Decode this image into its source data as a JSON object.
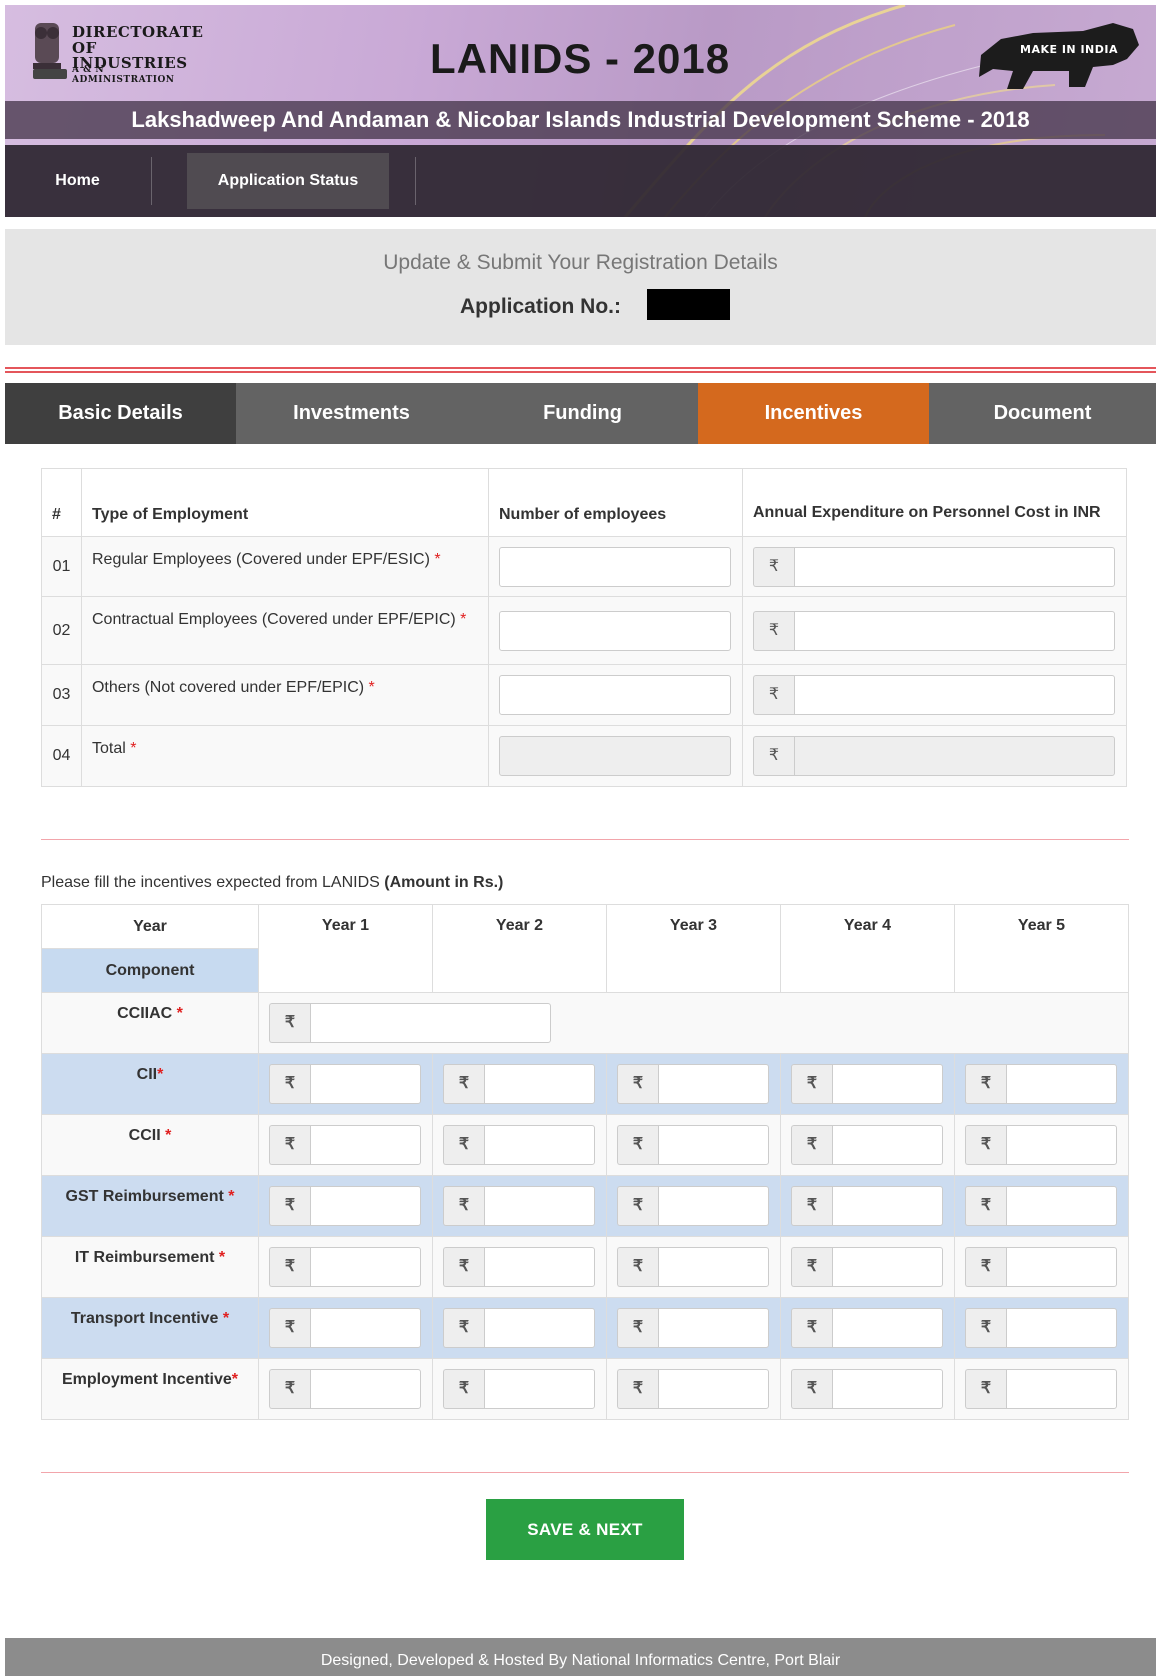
{
  "header": {
    "logo_line1": "DIRECTORATE",
    "logo_line2": "OF INDUSTRIES",
    "logo_line3": "A & N ADMINISTRATION",
    "title": "LANIDS - 2018",
    "make_in_india": "MAKE IN INDIA",
    "subtitle": "Lakshadweep And Andaman & Nicobar Islands Industrial Development Scheme - 2018"
  },
  "nav": {
    "home": "Home",
    "application_status": "Application Status"
  },
  "intro": {
    "title": "Update & Submit Your Registration Details",
    "app_label": "Application No.:"
  },
  "tabs": [
    "Basic Details",
    "Investments",
    "Funding",
    "Incentives",
    "Document"
  ],
  "active_tab": "Incentives",
  "employment": {
    "headers": {
      "num": "#",
      "type": "Type of Employment",
      "count": "Number of employees",
      "cost": "Annual Expenditure on Personnel Cost in INR"
    },
    "rows": [
      {
        "num": "01",
        "label": "Regular Employees (Covered under EPF/ESIC)"
      },
      {
        "num": "02",
        "label": "Contractual Employees (Covered under EPF/EPIC)"
      },
      {
        "num": "03",
        "label": "Others (Not covered under EPF/EPIC)"
      },
      {
        "num": "04",
        "label": "Total"
      }
    ]
  },
  "incentives": {
    "note": "Please fill the incentives expected from LANIDS",
    "note_bold": "(Amount in Rs.)",
    "year_header": "Year",
    "component_header": "Component",
    "years": [
      "Year 1",
      "Year 2",
      "Year 3",
      "Year 4",
      "Year 5"
    ],
    "currency_symbol": "₹",
    "rows": [
      {
        "label": "CCIIAC",
        "star": " *"
      },
      {
        "label": "CII",
        "star": "*"
      },
      {
        "label": "CCII",
        "star": " *"
      },
      {
        "label": "GST Reimbursement",
        "star": " *"
      },
      {
        "label": "IT Reimbursement",
        "star": " *"
      },
      {
        "label": "Transport Incentive",
        "star": " *"
      },
      {
        "label": "Employment Incentive",
        "star": "*"
      }
    ]
  },
  "save_button": "SAVE & NEXT",
  "footer": "Designed, Developed & Hosted By National Informatics Centre, Port Blair",
  "colors": {
    "active_tab": "#d4691e",
    "save_button": "#2aa043",
    "required_star": "#e02020",
    "band": "#ccdcf0"
  }
}
